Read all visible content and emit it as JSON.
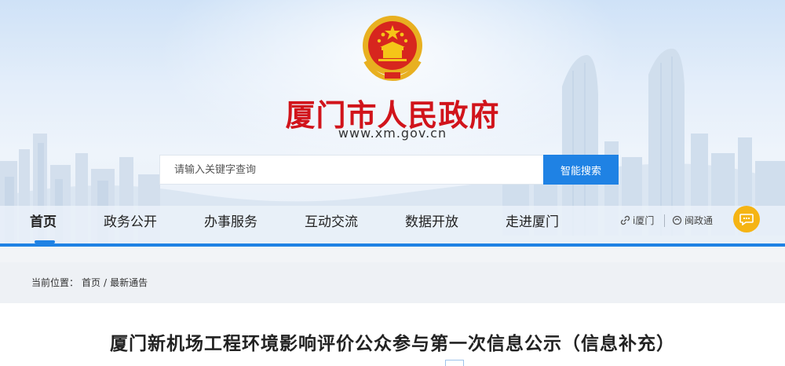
{
  "header": {
    "site_title": "厦门市人民政府",
    "site_url": "www.xm.gov.cn",
    "emblem_icon": "national-emblem-icon"
  },
  "search": {
    "placeholder": "请输入关键字查询",
    "button_label": "智能搜索"
  },
  "nav": {
    "items": [
      {
        "label": "首页",
        "active": true
      },
      {
        "label": "政务公开",
        "active": false
      },
      {
        "label": "办事服务",
        "active": false
      },
      {
        "label": "互动交流",
        "active": false
      },
      {
        "label": "数据开放",
        "active": false
      },
      {
        "label": "走进厦门",
        "active": false
      }
    ],
    "tools": [
      {
        "label": "i厦门",
        "icon": "link-icon"
      },
      {
        "label": "闽政通",
        "icon": "mzt-icon"
      }
    ],
    "chat_icon": "chat-icon"
  },
  "breadcrumb": {
    "prefix": "当前位置：",
    "items": [
      "首页",
      "/",
      "最新通告"
    ]
  },
  "article": {
    "title": "厦门新机场工程环境影响评价公众参与第一次信息公示（信息补充）"
  },
  "colors": {
    "accent_blue": "#1f82e4",
    "title_red": "#d1141b",
    "chat_orange": "#f5b414"
  }
}
